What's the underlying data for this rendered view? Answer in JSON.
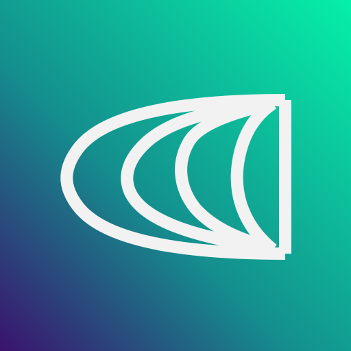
{
  "icon": {
    "name": "curved-arc-logo",
    "gradient": {
      "top_right": "#05f0a8",
      "middle": "#148f8e",
      "bottom_left": "#3b126e"
    },
    "mark_color": "#f2f2f2"
  }
}
